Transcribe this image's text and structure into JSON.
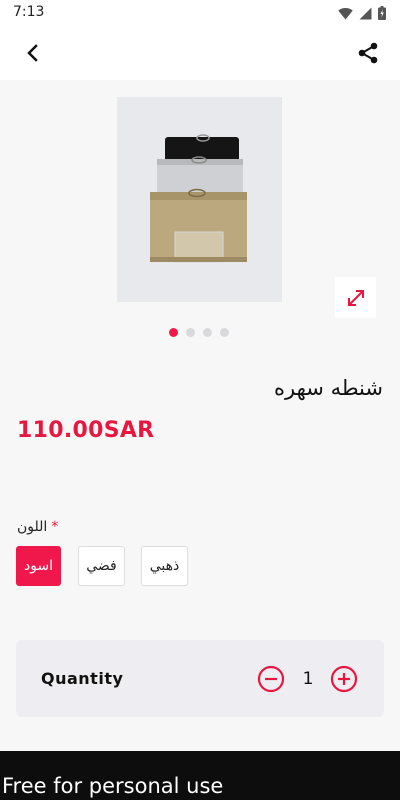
{
  "status_bar": {
    "time": "7:13"
  },
  "icons": {
    "back": "back-arrow-icon",
    "share": "share-icon",
    "expand": "expand-arrows-icon",
    "minus": "minus-circle-icon",
    "plus": "plus-circle-icon"
  },
  "colors": {
    "accent": "#e8173f",
    "chip_selected": "#f0184a"
  },
  "product": {
    "title": "شنطه سهره",
    "price": "110.00SAR",
    "image_count": 4,
    "active_image_index": 0
  },
  "option": {
    "label": "اللون",
    "required_marker": "*",
    "values": [
      "اسود",
      "فضي",
      "ذهبي"
    ],
    "selected": "اسود"
  },
  "quantity": {
    "label": "Quantity",
    "value": "1"
  },
  "watermark": "Free for personal use"
}
